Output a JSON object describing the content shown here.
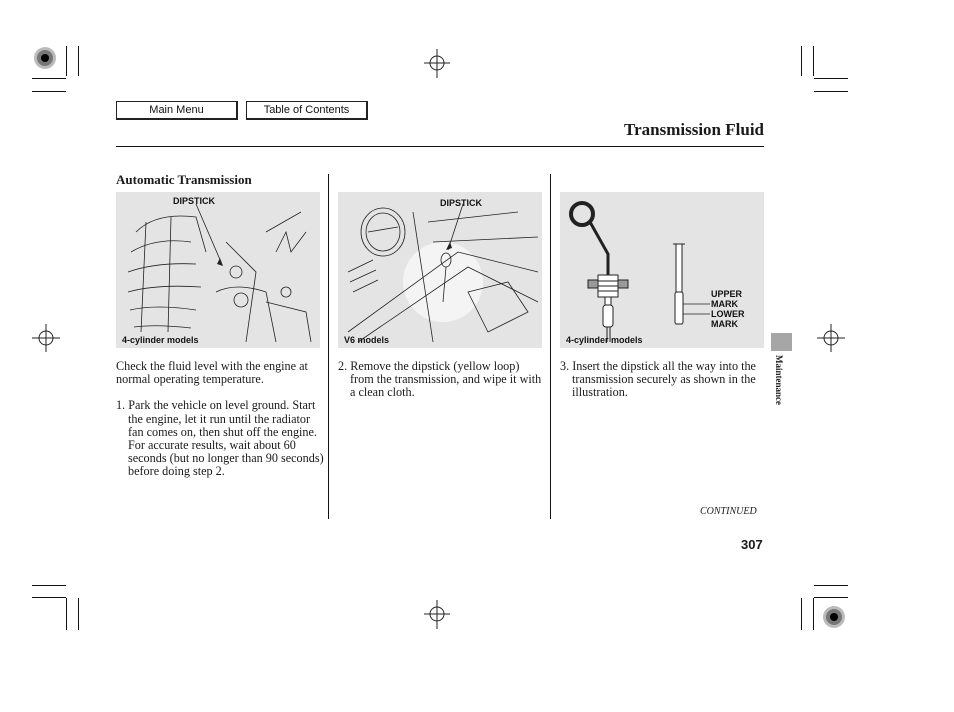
{
  "nav": {
    "main_menu_label": "Main Menu",
    "toc_label": "Table of Contents"
  },
  "header": {
    "title": "Transmission Fluid"
  },
  "section": {
    "heading": "Automatic Transmission"
  },
  "figures": [
    {
      "callout": "DIPSTICK",
      "caption": "4-cylinder models"
    },
    {
      "callout": "DIPSTICK",
      "caption": "V6 models"
    },
    {
      "upper_mark": "UPPER\nMARK",
      "upper_line1": "UPPER",
      "upper_line2": "MARK",
      "lower_line1": "LOWER",
      "lower_line2": "MARK",
      "caption": "4-cylinder models"
    }
  ],
  "columns": {
    "col1": {
      "intro": "Check the fluid level with the engine at normal operating temperature.",
      "step1": "1. Park the vehicle on level ground. Start the engine, let it run until the radiator fan comes on, then shut off the engine. For accurate results, wait about 60 seconds (but no longer than 90 seconds) before doing step 2."
    },
    "col2": {
      "step2": "2. Remove the dipstick (yellow loop) from the transmission, and wipe it with a clean cloth."
    },
    "col3": {
      "step3": "3. Insert the dipstick all the way into the transmission securely as shown in the illustration."
    }
  },
  "side_tab": {
    "label": "Maintenance",
    "color": "#a6a6a6"
  },
  "footer": {
    "continued": "CONTINUED",
    "page_number": "307"
  }
}
